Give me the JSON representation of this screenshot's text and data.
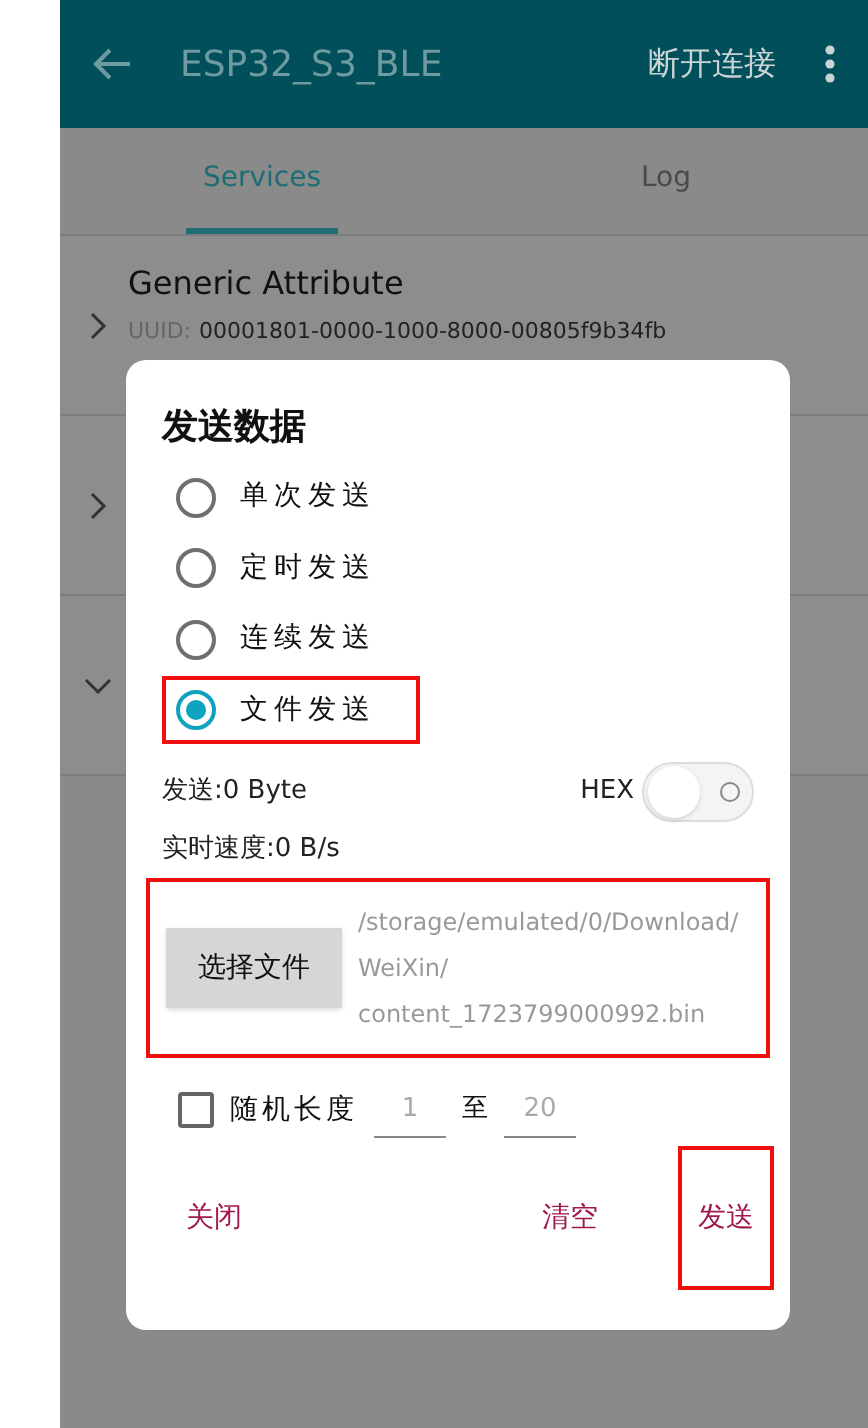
{
  "app_bar": {
    "title": "ESP32_S3_BLE",
    "action": "断开连接"
  },
  "tabs": [
    {
      "label": "Services",
      "selected": true
    },
    {
      "label": "Log",
      "selected": false
    }
  ],
  "services": [
    {
      "name": "Generic Attribute",
      "uuid_label": "UUID:",
      "uuid": "00001801-0000-1000-8000-00805f9b34fb",
      "expanded": false
    },
    {
      "expanded": false
    },
    {
      "expanded": true
    }
  ],
  "dialog": {
    "title": "发送数据",
    "modes": [
      {
        "label": "单次发送",
        "selected": false,
        "highlighted": false
      },
      {
        "label": "定时发送",
        "selected": false,
        "highlighted": false
      },
      {
        "label": "连续发送",
        "selected": false,
        "highlighted": false
      },
      {
        "label": "文件发送",
        "selected": true,
        "highlighted": true
      }
    ],
    "sent": "发送:0 Byte",
    "hex": {
      "label": "HEX",
      "on": false
    },
    "speed": "实时速度:0 B/s",
    "file": {
      "button": "选择文件",
      "path": "/storage/emulated/0/Download/WeiXin/content_1723799000992.bin",
      "highlighted": true
    },
    "random_length": {
      "label": "随机长度",
      "checked": false,
      "min_placeholder": "1",
      "separator": "至",
      "max_placeholder": "20"
    },
    "buttons": [
      {
        "label": "关闭",
        "highlighted": false
      },
      {
        "label": "清空",
        "highlighted": false
      },
      {
        "label": "发送",
        "highlighted": true
      }
    ]
  }
}
